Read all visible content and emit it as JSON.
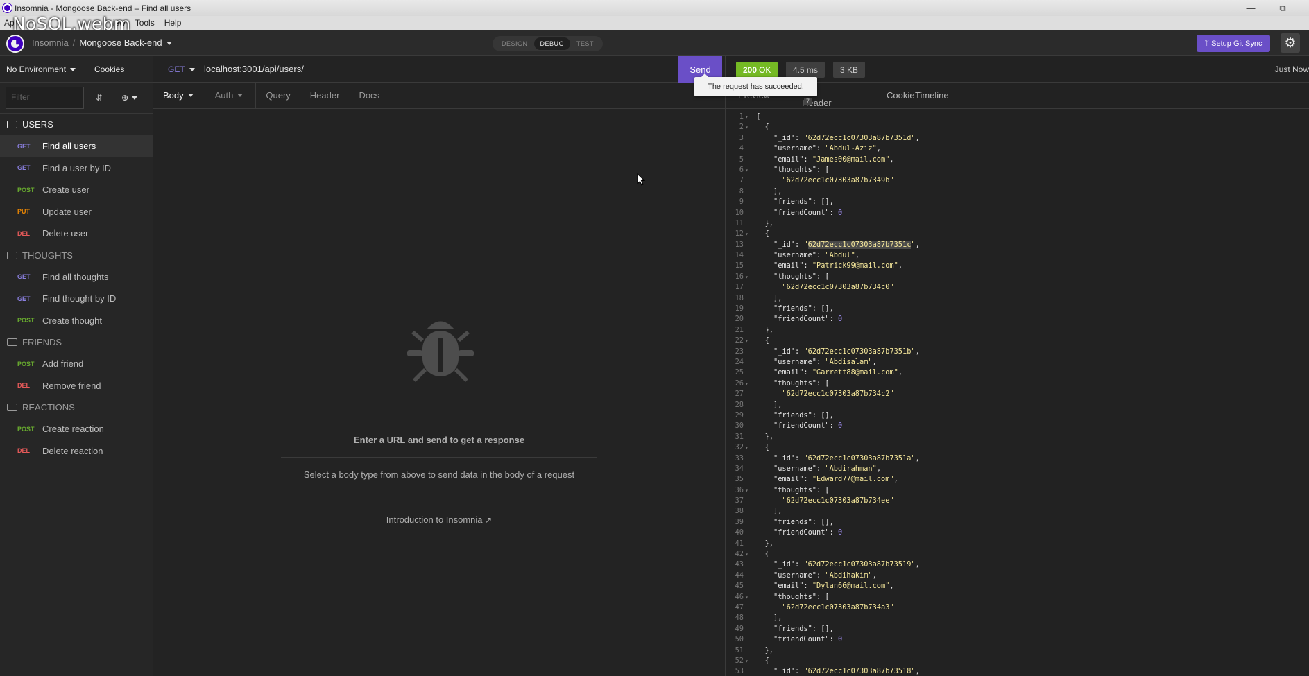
{
  "window": {
    "title": "Insomnia - Mongoose Back-end – Find all users",
    "overlay_label": "NoSQL.webm"
  },
  "menubar": {
    "items": [
      "Ap",
      "iew",
      "Tools",
      "Help"
    ]
  },
  "appbar": {
    "workspace": "Insomnia",
    "separator": "/",
    "project": "Mongoose Back-end",
    "modes": [
      "DESIGN",
      "DEBUG",
      "TEST"
    ],
    "active_mode": "DEBUG",
    "git_sync_label": "ᛘ Setup Git Sync"
  },
  "sidebar": {
    "environment": "No Environment",
    "cookies": "Cookies",
    "filter_placeholder": "Filter",
    "groups": [
      {
        "name": "USERS",
        "open": true,
        "requests": [
          {
            "method": "GET",
            "name": "Find all users",
            "active": true
          },
          {
            "method": "GET",
            "name": "Find a user by ID"
          },
          {
            "method": "POST",
            "name": "Create user"
          },
          {
            "method": "PUT",
            "name": "Update user"
          },
          {
            "method": "DEL",
            "name": "Delete user"
          }
        ]
      },
      {
        "name": "THOUGHTS",
        "requests": [
          {
            "method": "GET",
            "name": "Find all thoughts"
          },
          {
            "method": "GET",
            "name": "Find thought by ID"
          },
          {
            "method": "POST",
            "name": "Create thought"
          }
        ]
      },
      {
        "name": "FRIENDS",
        "requests": [
          {
            "method": "POST",
            "name": "Add friend"
          },
          {
            "method": "DEL",
            "name": "Remove friend"
          }
        ]
      },
      {
        "name": "REACTIONS",
        "requests": [
          {
            "method": "POST",
            "name": "Create reaction"
          },
          {
            "method": "DEL",
            "name": "Delete reaction"
          }
        ]
      }
    ]
  },
  "request": {
    "method": "GET",
    "url": "localhost:3001/api/users/",
    "send_label": "Send",
    "tabs": [
      "Body",
      "Auth",
      "Query",
      "Header",
      "Docs"
    ],
    "empty_title": "Enter a URL and send to get a response",
    "empty_subtitle": "Select a body type from above to send data in the body of a request",
    "intro_link": "Introduction to Insomnia"
  },
  "response": {
    "status_code": "200",
    "status_text": "OK",
    "time": "4.5 ms",
    "size": "3 KB",
    "timestamp": "Just Now",
    "tooltip": "The request has succeeded.",
    "tabs": [
      "Preview",
      "Header",
      "Cookie",
      "Timeline"
    ],
    "header_count": "7",
    "users": [
      {
        "_id": "62d72ecc1c07303a87b7351d",
        "username": "Abdul-Aziz",
        "email": "James00@mail.com",
        "thought": "62d72ecc1c07303a87b7349b"
      },
      {
        "_id": "62d72ecc1c07303a87b7351c",
        "username": "Abdul",
        "email": "Patrick99@mail.com",
        "thought": "62d72ecc1c07303a87b734c0"
      },
      {
        "_id": "62d72ecc1c07303a87b7351b",
        "username": "Abdisalam",
        "email": "Garrett88@mail.com",
        "thought": "62d72ecc1c07303a87b734c2"
      },
      {
        "_id": "62d72ecc1c07303a87b7351a",
        "username": "Abdirahman",
        "email": "Edward77@mail.com",
        "thought": "62d72ecc1c07303a87b734ee"
      },
      {
        "_id": "62d72ecc1c07303a87b73519",
        "username": "Abdihakim",
        "email": "Dylan66@mail.com",
        "thought": "62d72ecc1c07303a87b734a3"
      },
      {
        "_id": "62d72ecc1c07303a87b73518"
      }
    ],
    "friend_count": "0",
    "highlighted_id": "62d72ecc1c07303a87b7351c"
  },
  "colors": {
    "accent": "#6a4fc7",
    "ok": "#75ba24",
    "get": "#8a7fdf",
    "post": "#69ac2f",
    "put": "#ec8702",
    "del": "#e85a5a"
  }
}
